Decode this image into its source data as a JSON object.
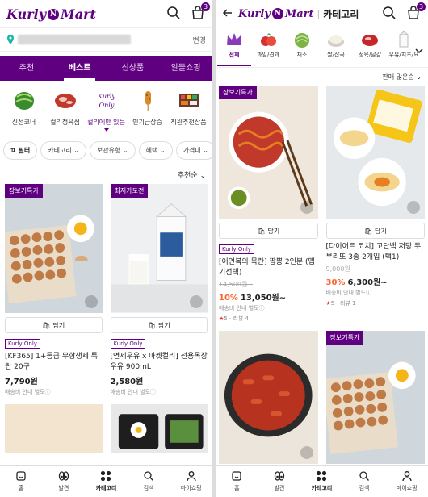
{
  "left": {
    "logo": {
      "pre": "Kurly",
      "n": "N",
      "post": "Mart"
    },
    "cart_badge": "3",
    "address_change": "변경",
    "tabs": [
      {
        "label": "추천",
        "active": false
      },
      {
        "label": "베스트",
        "active": true
      },
      {
        "label": "신상품",
        "active": false
      },
      {
        "label": "알뜰쇼핑",
        "active": false
      }
    ],
    "categories": [
      {
        "label": "신선코너"
      },
      {
        "label": "컬리정육점"
      },
      {
        "label": "컬리에만 있는",
        "active": true,
        "logo_text": "Kurly Only"
      },
      {
        "label": "인기급상승"
      },
      {
        "label": "직원추천상품"
      }
    ],
    "filters": {
      "filter": "필터",
      "chips": [
        "카테고리",
        "보관유형",
        "혜택",
        "가격대"
      ]
    },
    "sort": "추천순",
    "products": [
      {
        "tag": "장보기특가",
        "cart": "담기",
        "kurly_only": "Kurly Only",
        "name": "[KF365] 1+등급 무항생제 특란 20구",
        "price": "7,790원",
        "ship": "배송비 안내 별도ⓘ"
      },
      {
        "tag": "최저가도전",
        "cart": "담기",
        "kurly_only": "Kurly Only",
        "name": "[연세우유 x 마켓컬리] 전용목장 우유 900mL",
        "price": "2,580원",
        "ship": "배송비 안내 별도ⓘ"
      }
    ],
    "nav": [
      {
        "label": "홈",
        "icon": "home-icon"
      },
      {
        "label": "발견",
        "icon": "discover-icon"
      },
      {
        "label": "카테고리",
        "icon": "category-icon",
        "active": true
      },
      {
        "label": "검색",
        "icon": "search-icon"
      },
      {
        "label": "마이쇼핑",
        "icon": "user-icon"
      }
    ]
  },
  "right": {
    "logo": {
      "pre": "Kurly",
      "n": "N",
      "post": "Mart"
    },
    "title": "카테고리",
    "cart_badge": "3",
    "categories": [
      {
        "label": "전체",
        "active": true
      },
      {
        "label": "과일/견과"
      },
      {
        "label": "채소"
      },
      {
        "label": "쌀/잡곡"
      },
      {
        "label": "정육/달걀"
      },
      {
        "label": "우유/치즈/요"
      }
    ],
    "sort": "판매 많은순",
    "products": [
      {
        "tag": "장보기특가",
        "cart": "담기",
        "kurly_only": "Kurly Only",
        "name": "[이연복의 목란] 짬뽕 2인분 (맵기선택)",
        "orig": "14,500원~",
        "discount": "10%",
        "price": "13,050원~",
        "ship": "배송비 안내 별도ⓘ",
        "rating": "5",
        "reviews": "리뷰 4"
      },
      {
        "tag": "",
        "cart": "담기",
        "kurly_only": "",
        "name": "[다이어트 코치] 고단백 저당 두부리또 3종 2개입 (택1)",
        "orig": "9,000원~",
        "discount": "30%",
        "price": "6,300원~",
        "ship": "배송비 안내 별도ⓘ",
        "rating": "5",
        "reviews": "리뷰 1"
      }
    ],
    "lower_tag": "장보기특가",
    "nav": [
      {
        "label": "홈",
        "icon": "home-icon"
      },
      {
        "label": "발견",
        "icon": "discover-icon"
      },
      {
        "label": "카테고리",
        "icon": "category-icon",
        "active": true
      },
      {
        "label": "검색",
        "icon": "search-icon"
      },
      {
        "label": "마이쇼핑",
        "icon": "user-icon"
      }
    ]
  },
  "colors": {
    "brand": "#5f0080",
    "discount": "#fa622f",
    "star": "#e8322f"
  }
}
